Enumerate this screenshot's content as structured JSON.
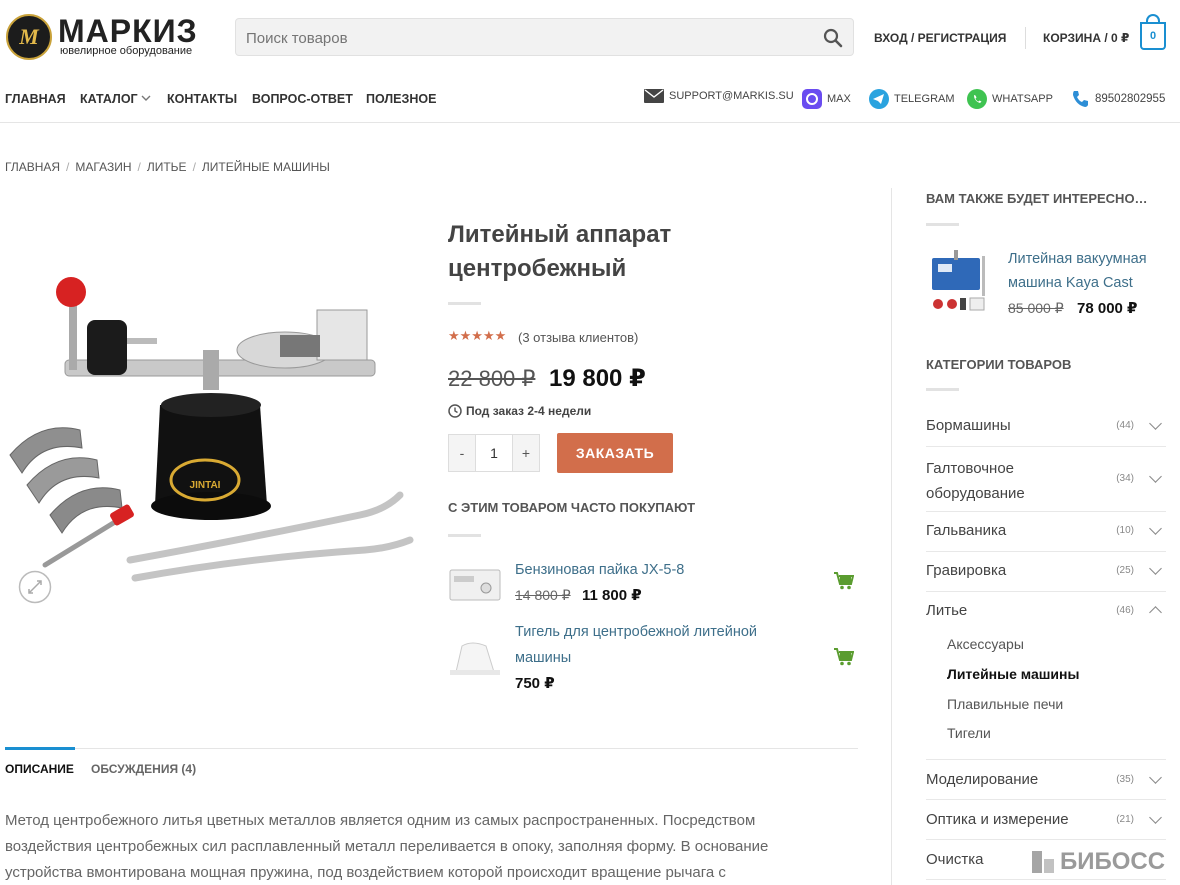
{
  "header": {
    "logo_title": "МАРКИЗ",
    "logo_subtitle": "ювелирное оборудование",
    "logo_monogram": "M",
    "search_placeholder": "Поиск товаров",
    "login": "ВХОД / РЕГИСТРАЦИЯ",
    "cart_label": "КОРЗИНА / 0 ₽",
    "cart_count": "0"
  },
  "nav": {
    "items": [
      "ГЛАВНАЯ",
      "КАТАЛОГ",
      "КОНТАКТЫ",
      "ВОПРОС-ОТВЕТ",
      "ПОЛЕЗНОЕ"
    ]
  },
  "contacts": {
    "email": "SUPPORT@MARKIS.SU",
    "max": "MAX",
    "telegram": "TELEGRAM",
    "whatsapp": "WHATSAPP",
    "phone": "89502802955"
  },
  "breadcrumb": [
    "ГЛАВНАЯ",
    "МАГАЗИН",
    "ЛИТЬЕ",
    "ЛИТЕЙНЫЕ МАШИНЫ"
  ],
  "product": {
    "title_line1": "Литейный аппарат",
    "title_line2": "центробежный",
    "rating": 4.67,
    "stars": "★★★★★",
    "reviews": "(3 отзыва клиентов)",
    "old_price": "22 800 ₽",
    "price": "19 800 ₽",
    "availability": "Под заказ 2-4 недели",
    "qty_minus": "-",
    "qty_value": "1",
    "qty_plus": "+",
    "order_button": "ЗАКАЗАТЬ",
    "image_brand": "JINTAI"
  },
  "bought_together": {
    "title": "С ЭТИМ ТОВАРОМ ЧАСТО ПОКУПАЮТ",
    "items": [
      {
        "name": "Бензиновая пайка JX-5-8",
        "old_price": "14 800 ₽",
        "price": "11 800 ₽"
      },
      {
        "name_line1": "Тигель для центробежной литейной",
        "name_line2": "машины",
        "price": "750 ₽"
      }
    ]
  },
  "tabs": {
    "description": "ОПИСАНИЕ",
    "discussions": "ОБСУЖДЕНИЯ (4)"
  },
  "description": {
    "line1": "Метод центробежного литья цветных металлов является одним из самых распространенных. Посредством",
    "line2": "воздействия центробежных сил расплавленный металл переливается в опоку, заполняя форму. В основание",
    "line3": "устройства вмонтирована мощная пружина, под воздействием которой происходит вращение рычага с"
  },
  "sidebar": {
    "recommend_title": "ВАМ ТАКЖЕ БУДЕТ ИНТЕРЕСНО…",
    "recommend": {
      "name_line1": "Литейная вакуумная",
      "name_line2": "машина Kaya Cast",
      "old_price": "85 000 ₽",
      "price": "78 000 ₽"
    },
    "categories_title": "КАТЕГОРИИ ТОВАРОВ",
    "categories": [
      {
        "name": "Бормашины",
        "count": "(44)"
      },
      {
        "name_line1": "Галтовочное",
        "name_line2": "оборудование",
        "count": "(34)"
      },
      {
        "name": "Гальваника",
        "count": "(10)"
      },
      {
        "name": "Гравировка",
        "count": "(25)"
      },
      {
        "name": "Литье",
        "count": "(46)"
      },
      {
        "name": "Моделирование",
        "count": "(35)"
      },
      {
        "name": "Оптика и измерение",
        "count": "(21)"
      },
      {
        "name": "Очистка",
        "count": ""
      }
    ],
    "subcategories": [
      "Аксессуары",
      "Литейные машины",
      "Плавильные печи",
      "Тигели"
    ]
  },
  "watermark": "БИБОСС",
  "colors": {
    "accent": "#d26e4b",
    "blue": "#1a8fd1",
    "link": "#3e6f8a",
    "cart_green": "#5a9c2f"
  }
}
